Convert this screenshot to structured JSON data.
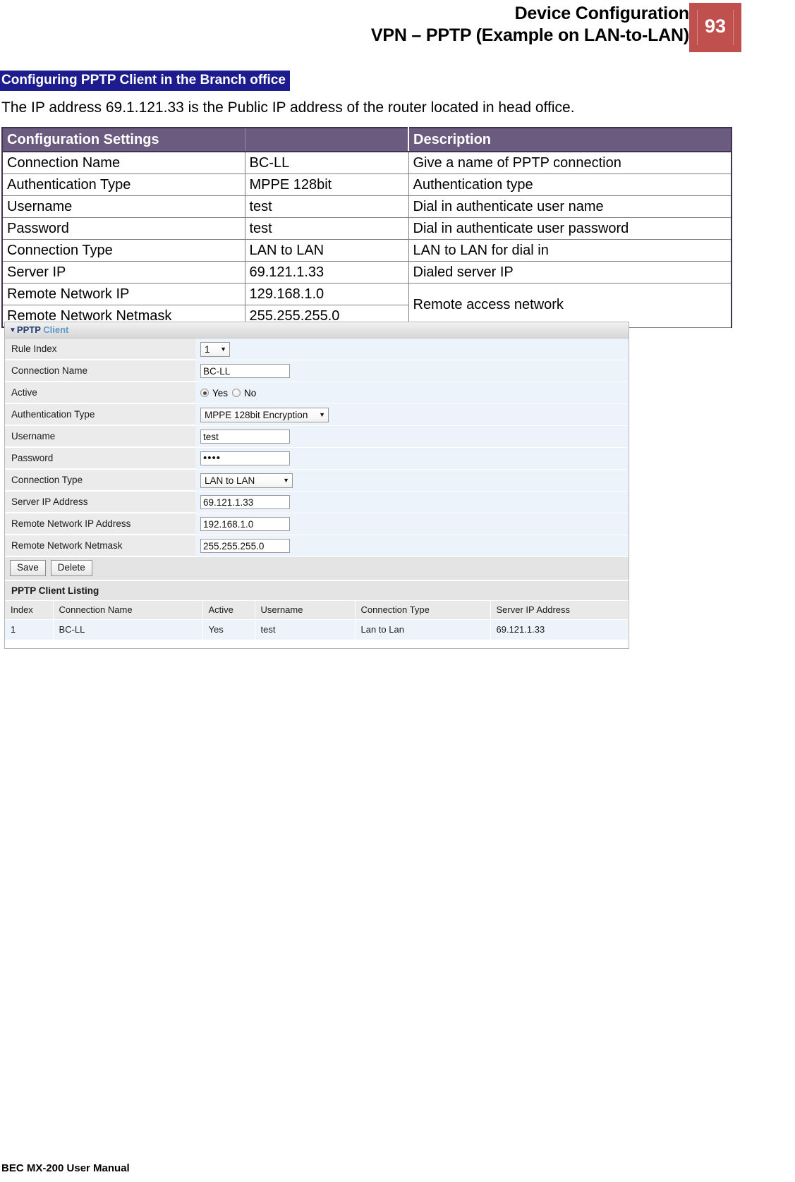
{
  "header": {
    "title_line1": "Device Configuration",
    "title_line2": "VPN – PPTP (Example on LAN-to-LAN)",
    "page_number": "93",
    "page_number_color": "#C0504D"
  },
  "section": {
    "heading": "Configuring PPTP Client in the Branch office",
    "heading_bg": "#1C1C8F",
    "intro": "The IP address 69.1.121.33 is the Public IP address of the router located in head office."
  },
  "config_table": {
    "header_bg": "#6B5B7E",
    "columns": [
      "Configuration Settings",
      "",
      "Description"
    ],
    "rows": [
      {
        "setting": "Connection Name",
        "value": "BC-LL",
        "description": "Give a name of PPTP connection"
      },
      {
        "setting": "Authentication Type",
        "value": "MPPE 128bit",
        "description": "Authentication type"
      },
      {
        "setting": "Username",
        "value": "test",
        "description": "Dial in authenticate user name"
      },
      {
        "setting": "Password",
        "value": "test",
        "description": "Dial in authenticate user password"
      },
      {
        "setting": "Connection Type",
        "value": "LAN to LAN",
        "description": "LAN to LAN for dial in"
      },
      {
        "setting": "Server IP",
        "value": "69.121.1.33",
        "description": "Dialed server IP"
      },
      {
        "setting": "Remote Network IP",
        "value": "129.168.1.0",
        "description": "Remote access network"
      },
      {
        "setting": "Remote Network Netmask",
        "value": "255.255.255.0",
        "description": ""
      }
    ]
  },
  "router_ui": {
    "panel_title_caret": "▼",
    "panel_title_part1": "PPTP",
    "panel_title_part2": "Client",
    "fields": {
      "rule_index_label": "Rule Index",
      "rule_index_value": "1",
      "connection_name_label": "Connection Name",
      "connection_name_value": "BC-LL",
      "active_label": "Active",
      "active_yes": "Yes",
      "active_no": "No",
      "auth_type_label": "Authentication Type",
      "auth_type_value": "MPPE 128bit Encryption",
      "username_label": "Username",
      "username_value": "test",
      "password_label": "Password",
      "password_value": "••••",
      "connection_type_label": "Connection Type",
      "connection_type_value": "LAN to LAN",
      "server_ip_label": "Server IP Address",
      "server_ip_value": "69.121.1.33",
      "remote_ip_label": "Remote Network IP Address",
      "remote_ip_value": "192.168.1.0",
      "remote_netmask_label": "Remote Network Netmask",
      "remote_netmask_value": "255.255.255.0"
    },
    "buttons": {
      "save": "Save",
      "delete": "Delete"
    },
    "listing": {
      "title": "PPTP Client Listing",
      "columns": [
        "Index",
        "Connection Name",
        "Active",
        "Username",
        "Connection Type",
        "Server IP Address"
      ],
      "rows": [
        {
          "index": "1",
          "connection_name": "BC-LL",
          "active": "Yes",
          "username": "test",
          "connection_type": "Lan to Lan",
          "server_ip": "69.121.1.33"
        }
      ]
    }
  },
  "footer": {
    "text": "BEC MX-200 User Manual"
  }
}
